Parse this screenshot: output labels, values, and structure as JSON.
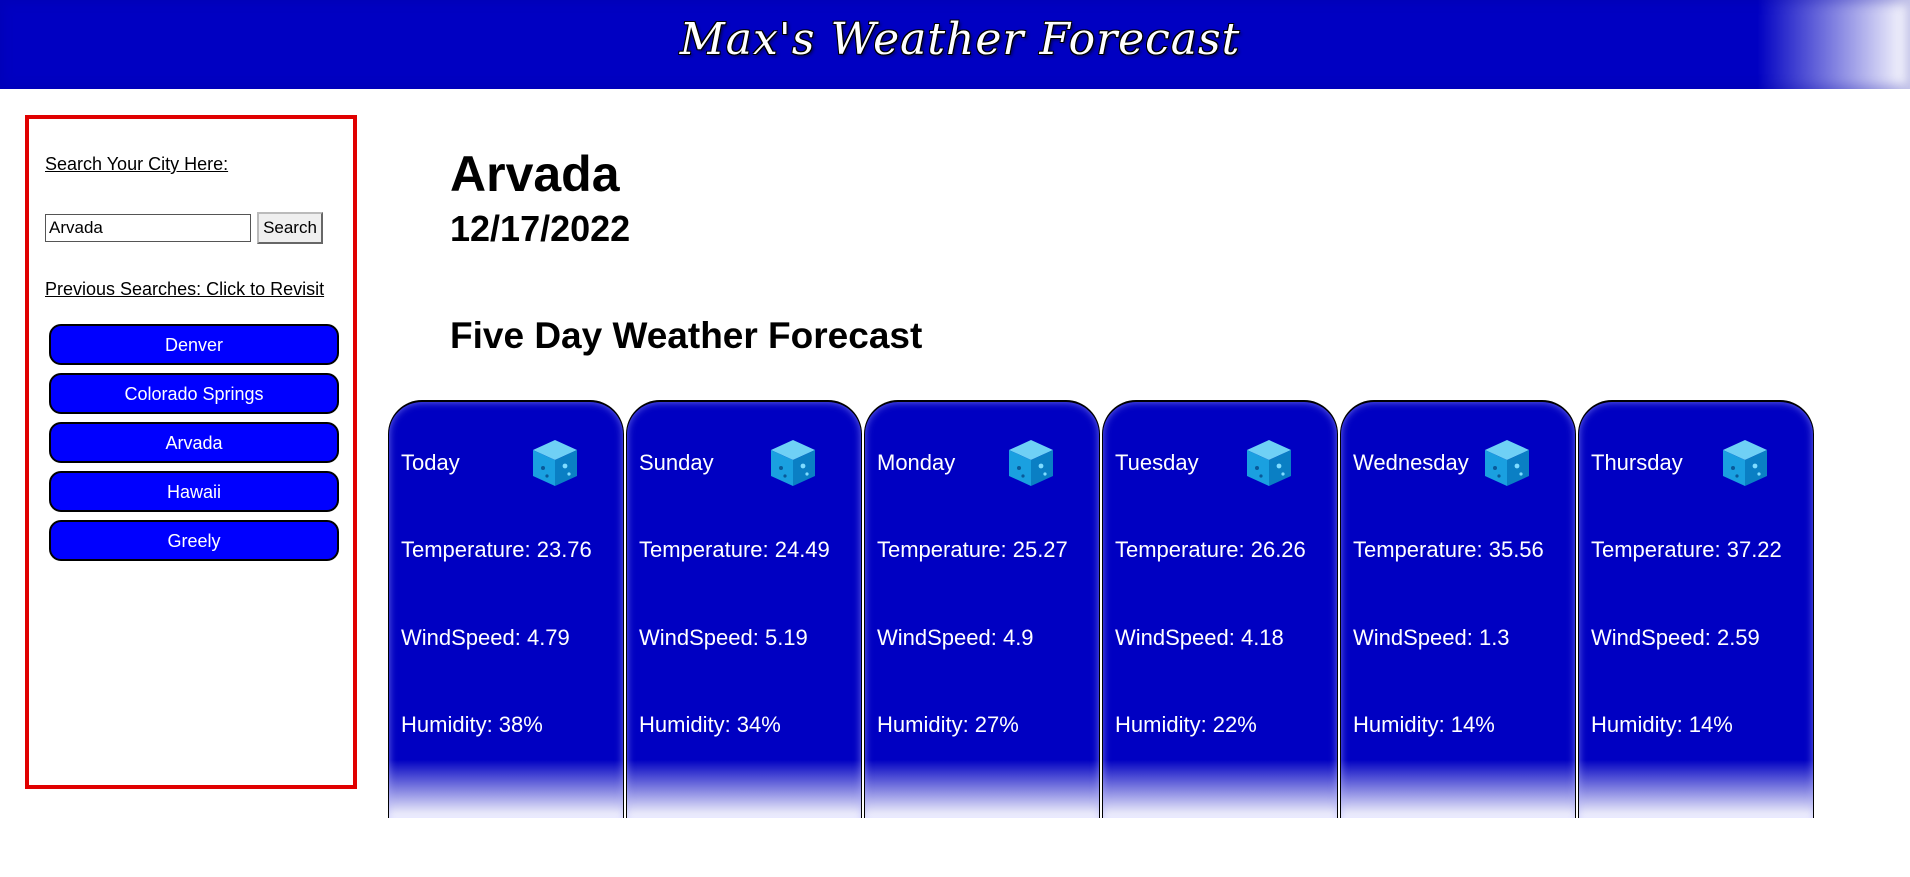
{
  "header": {
    "title": "Max's Weather Forecast"
  },
  "sidebar": {
    "search_label": "Search Your City Here:",
    "search_value": "Arvada",
    "search_button": "Search",
    "previous_label": "Previous Searches: Click to Revisit",
    "history": [
      "Denver",
      "Colorado Springs",
      "Arvada",
      "Hawaii",
      "Greely"
    ]
  },
  "main": {
    "city": "Arvada",
    "date": "12/17/2022",
    "forecast_heading": "Five Day Weather Forecast",
    "forecast": [
      {
        "day": "Today",
        "icon": "snow-cube-icon",
        "temperature": "Temperature: 23.76",
        "wind": "WindSpeed: 4.79",
        "humidity": "Humidity: 38%"
      },
      {
        "day": "Sunday",
        "icon": "snow-cube-icon",
        "temperature": "Temperature: 24.49",
        "wind": "WindSpeed: 5.19",
        "humidity": "Humidity: 34%"
      },
      {
        "day": "Monday",
        "icon": "snow-cube-icon",
        "temperature": "Temperature: 25.27",
        "wind": "WindSpeed: 4.9",
        "humidity": "Humidity: 27%"
      },
      {
        "day": "Tuesday",
        "icon": "snow-cube-icon",
        "temperature": "Temperature: 26.26",
        "wind": "WindSpeed: 4.18",
        "humidity": "Humidity: 22%"
      },
      {
        "day": "Wednesday",
        "icon": "snow-cube-icon",
        "temperature": "Temperature: 35.56",
        "wind": "WindSpeed: 1.3",
        "humidity": "Humidity: 14%"
      },
      {
        "day": "Thursday",
        "icon": "snow-cube-icon",
        "temperature": "Temperature: 37.22",
        "wind": "WindSpeed: 2.59",
        "humidity": "Humidity: 14%"
      }
    ]
  },
  "colors": {
    "banner_blue": "#0000c2",
    "history_button_blue": "#0000ff",
    "sidebar_border_red": "#e00000",
    "card_blue": "#0000c2"
  }
}
